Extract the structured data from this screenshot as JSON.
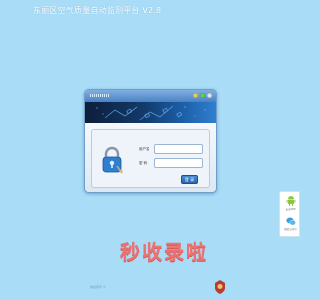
{
  "header": {
    "title": "东丽区空气质量自动监测平台 V2.8"
  },
  "login": {
    "username_label": "用户名",
    "password_label": "密  码",
    "username_value": "",
    "password_value": "",
    "submit_label": "登 录"
  },
  "float_panel": {
    "items": [
      {
        "label": "安卓APP",
        "icon": "android-icon"
      },
      {
        "label": "微信公众号",
        "icon": "wechat-icon"
      }
    ]
  },
  "watermark": {
    "text": "秒收录啦"
  },
  "footer": {
    "text": "版权所有 ©"
  },
  "colors": {
    "page_background": "#a9dcf6",
    "window_titlebar": "#4a82c4",
    "login_button": "#2a64ad",
    "watermark": "#ec7272"
  }
}
